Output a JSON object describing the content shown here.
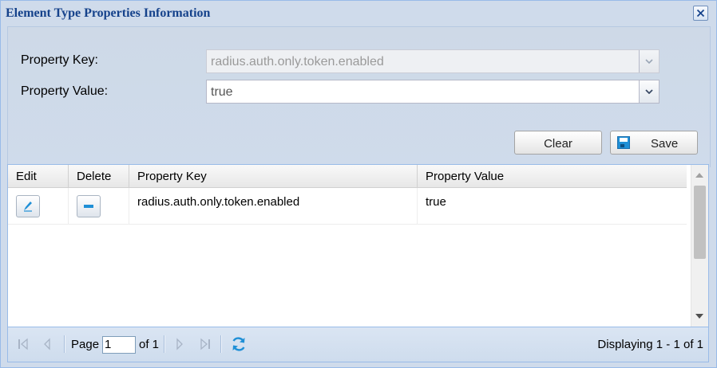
{
  "dialog": {
    "title": "Element Type Properties Information"
  },
  "form": {
    "property_key_label": "Property Key:",
    "property_key_value": "radius.auth.only.token.enabled",
    "property_value_label": "Property Value:",
    "property_value_value": "true",
    "clear_label": "Clear",
    "save_label": "Save"
  },
  "grid": {
    "columns": [
      "Edit",
      "Delete",
      "Property Key",
      "Property Value"
    ],
    "rows": [
      {
        "property_key": "radius.auth.only.token.enabled",
        "property_value": "true"
      }
    ]
  },
  "pager": {
    "page_label": "Page",
    "current_page": "1",
    "of_label": "of 1",
    "displaying": "Displaying 1 - 1 of 1"
  },
  "colors": {
    "title": "#15428b",
    "panel": "#cfdbeb",
    "border": "#99bbe8",
    "accent": "#1f8fd6"
  }
}
